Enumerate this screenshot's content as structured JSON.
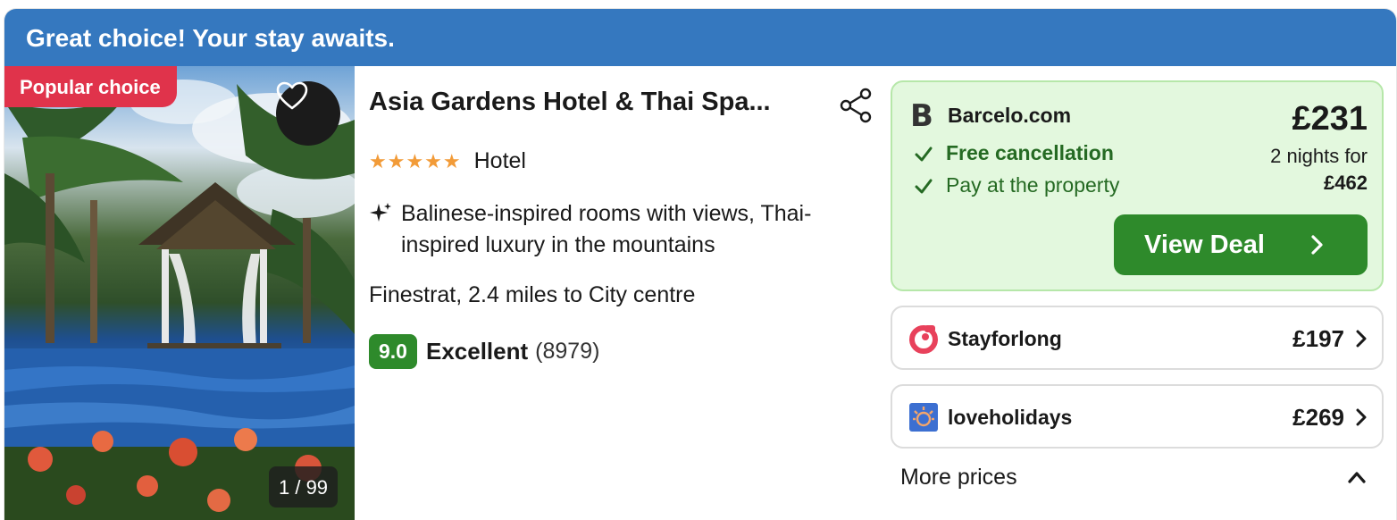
{
  "banner": {
    "text": "Great choice! Your stay awaits."
  },
  "photo": {
    "badge": "Popular choice",
    "counter": "1 / 99",
    "favorite_icon": "heart-outline-icon"
  },
  "hotel": {
    "name": "Asia Gardens Hotel & Thai Spa...",
    "stars": "★★★★★",
    "star_rating": 5,
    "type": "Hotel",
    "highlight": "Balinese-inspired rooms with views, Thai-inspired luxury in the mountains",
    "location": "Finestrat, 2.4 miles to City centre",
    "score": "9.0",
    "rating_label": "Excellent",
    "review_count": "(8979)"
  },
  "main_deal": {
    "provider_logo": "B",
    "provider": "Barcelo.com",
    "features": [
      "Free cancellation",
      "Pay at the property"
    ],
    "price": "£231",
    "nights_label": "2 nights for",
    "total": "£462",
    "button": "View Deal"
  },
  "other_deals": [
    {
      "provider": "Stayforlong",
      "price": "£197",
      "logo_color": "#e8415b"
    },
    {
      "provider": "loveholidays",
      "price": "£269",
      "logo_color": "#3c6fd1"
    }
  ],
  "more_prices": "More prices",
  "colors": {
    "banner": "#3578bf",
    "popular_badge": "#e0334b",
    "deal_green": "#2e8a2b",
    "deal_bg": "#e3f8de",
    "stars": "#f29b38"
  }
}
